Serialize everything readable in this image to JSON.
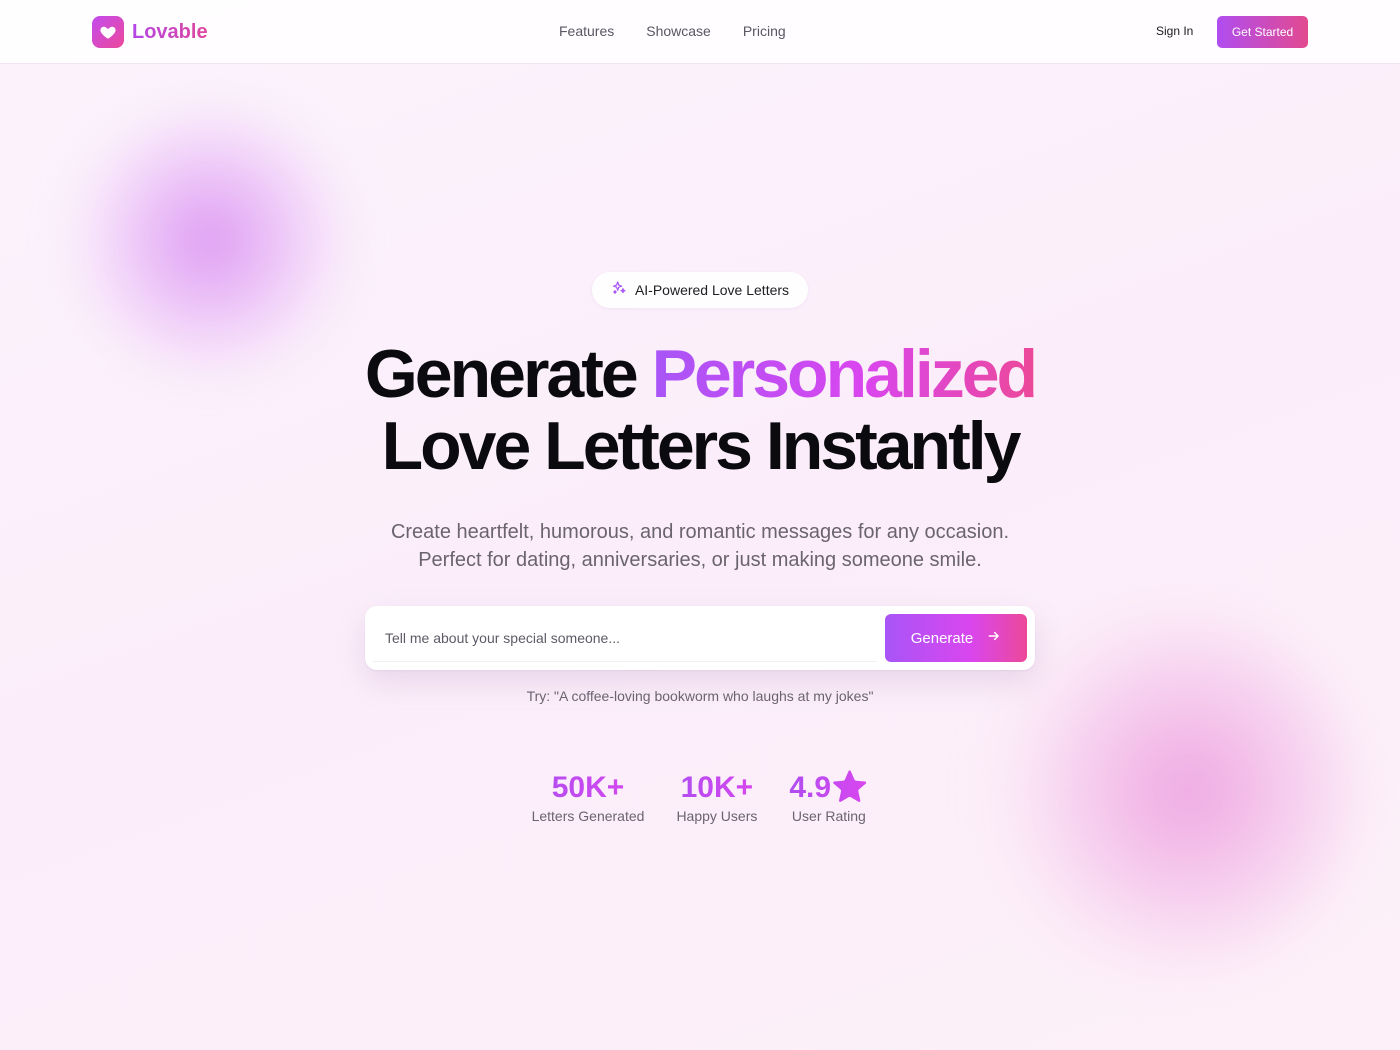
{
  "nav": {
    "brand": "Lovable",
    "links": [
      "Features",
      "Showcase",
      "Pricing"
    ],
    "sign_in": "Sign In",
    "get_started": "Get Started"
  },
  "hero": {
    "badge": "AI-Powered Love Letters",
    "headline_part1": "Generate ",
    "headline_highlight": "Personalized",
    "headline_part2": "Love Letters Instantly",
    "subtitle_line1": "Create heartfelt, humorous, and romantic messages for any occasion.",
    "subtitle_line2": "Perfect for dating, anniversaries, or just making someone smile."
  },
  "prompt": {
    "placeholder": "Tell me about your special someone...",
    "value": "",
    "button_label": "Generate",
    "hint": "Try: \"A coffee-loving bookworm who laughs at my jokes\""
  },
  "stats": [
    {
      "value": "50K+",
      "label": "Letters Generated"
    },
    {
      "value": "10K+",
      "label": "Happy Users"
    },
    {
      "value": "4.9⭐",
      "label": "User Rating"
    }
  ],
  "colors": {
    "brand_purple": "#a855f7",
    "brand_pink": "#ec4899",
    "background": "#fbf3fc"
  },
  "icons": {
    "logo": "heart-icon",
    "badge": "sparkles-icon",
    "generate": "arrow-right-icon"
  }
}
